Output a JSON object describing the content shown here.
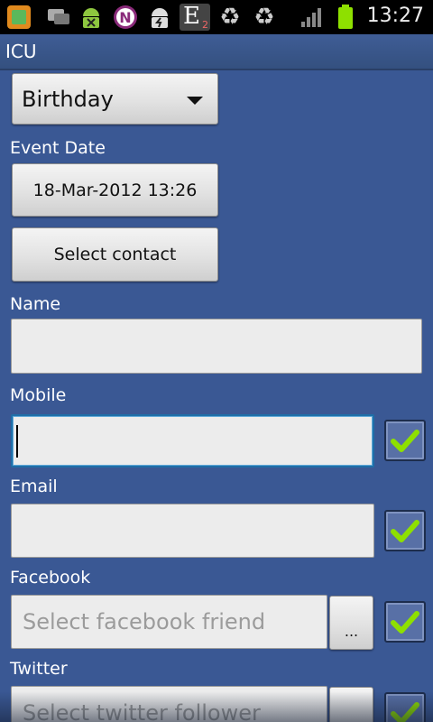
{
  "status_bar": {
    "time": "13:27",
    "notification_icons": [
      "app-shortcut-icon",
      "chat-icon",
      "android-debug-icon",
      "n-app-icon",
      "android-usb-icon",
      "e2-app-icon",
      "recycle-icon",
      "recycle-icon"
    ],
    "e2_label": "E",
    "e2_sub": "2",
    "n_label": "N"
  },
  "app": {
    "title": "ICU"
  },
  "form": {
    "event_type": {
      "value": "Birthday"
    },
    "event_date": {
      "label": "Event Date",
      "value": "18-Mar-2012 13:26"
    },
    "select_contact": {
      "label": "Select contact"
    },
    "name": {
      "label": "Name",
      "value": ""
    },
    "mobile": {
      "label": "Mobile",
      "value": "",
      "checked": true
    },
    "email": {
      "label": "Email",
      "value": "",
      "checked": true
    },
    "facebook": {
      "label": "Facebook",
      "placeholder": "Select facebook friend",
      "browse_label": "...",
      "checked": true
    },
    "twitter": {
      "label": "Twitter",
      "placeholder": "Select twitter follower",
      "browse_label": "...",
      "checked": true
    }
  },
  "colors": {
    "background": "#3a5894",
    "check_green": "#8ee000",
    "focus_border": "#1f6fa8"
  }
}
